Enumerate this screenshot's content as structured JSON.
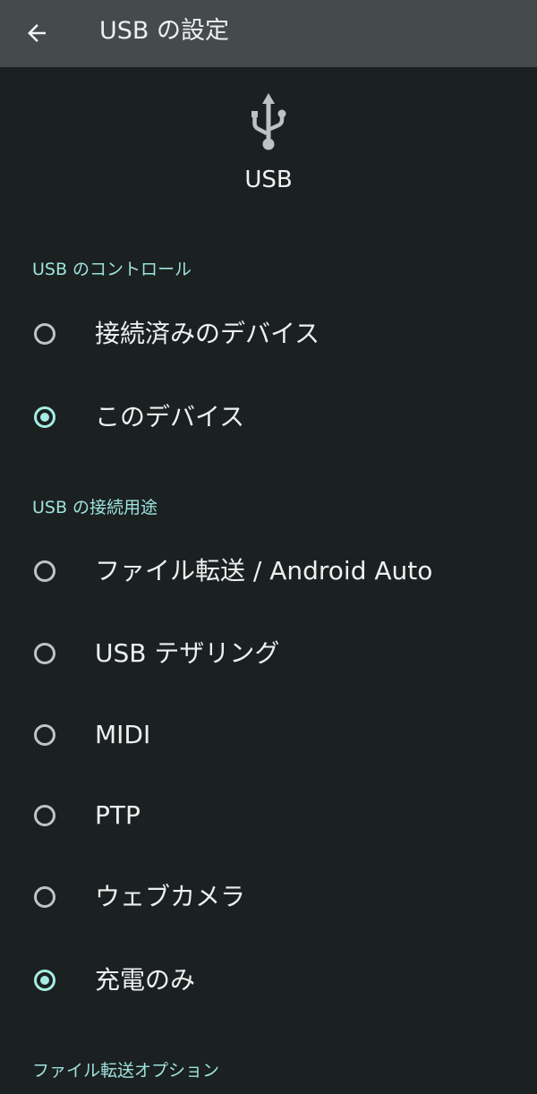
{
  "appbar": {
    "title": "USB の設定",
    "back_icon": "arrow-back-icon"
  },
  "header": {
    "icon": "usb-icon",
    "title": "USB"
  },
  "sections": [
    {
      "header": "USB のコントロール",
      "options": [
        {
          "label": "接続済みのデバイス",
          "checked": false
        },
        {
          "label": "このデバイス",
          "checked": true
        }
      ]
    },
    {
      "header": "USB の接続用途",
      "options": [
        {
          "label": "ファイル転送 / Android Auto",
          "checked": false
        },
        {
          "label": "USB テザリング",
          "checked": false
        },
        {
          "label": "MIDI",
          "checked": false
        },
        {
          "label": "PTP",
          "checked": false
        },
        {
          "label": "ウェブカメラ",
          "checked": false
        },
        {
          "label": "充電のみ",
          "checked": true
        }
      ]
    },
    {
      "header": "ファイル転送オプション",
      "options": []
    }
  ],
  "colors": {
    "background": "#1b2021",
    "appbar": "#454a4b",
    "accent": "#a7ece4",
    "section_header": "#9ee3dd"
  }
}
